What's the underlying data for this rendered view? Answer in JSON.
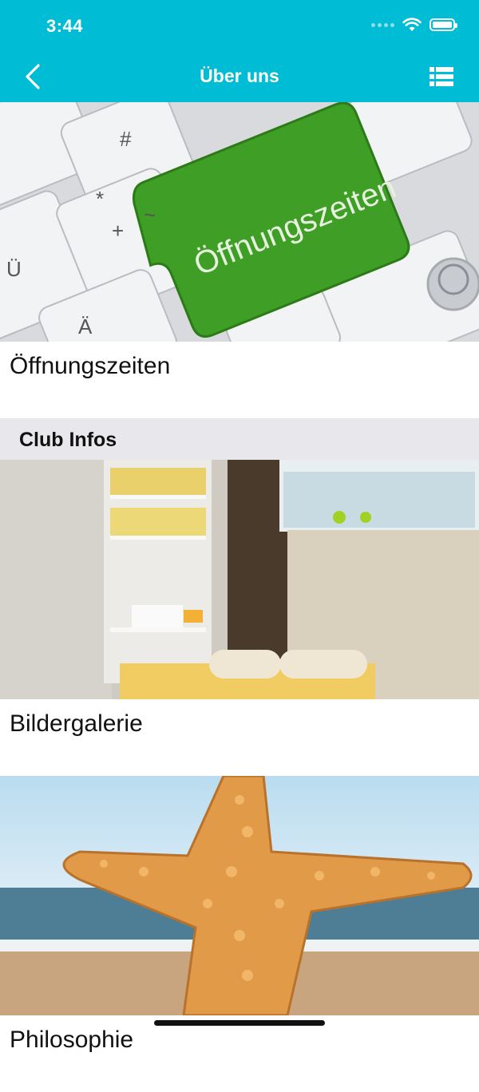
{
  "status_bar": {
    "time": "3:44"
  },
  "nav": {
    "title": "Über uns",
    "back_icon": "chevron-left-icon",
    "menu_icon": "list-icon"
  },
  "items": [
    {
      "label": "Öffnungszeiten",
      "image": "keyboard-green-key",
      "key_text": "Öffnungszeiten"
    },
    {
      "label": "Bildergalerie",
      "image": "room-shelves-loungers"
    },
    {
      "label": "Philosophie",
      "image": "starfish-beach"
    }
  ],
  "section": {
    "title": "Club Infos"
  },
  "colors": {
    "accent": "#00bcd4",
    "section_bg": "#e8e8ec",
    "key_green": "#3f9e26"
  }
}
